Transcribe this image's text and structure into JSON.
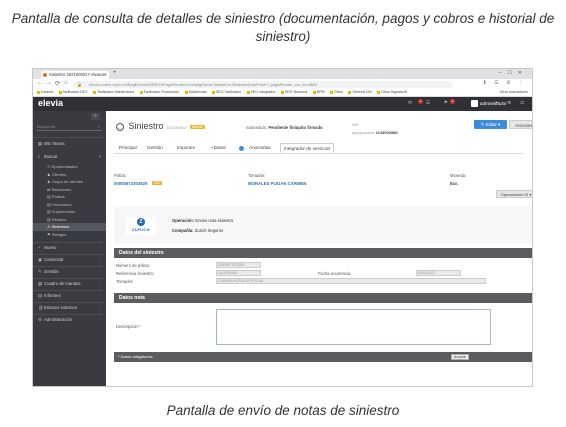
{
  "captions": {
    "top": "Pantalla de consulta de detalles de siniestro (documentación, pagos y cobros e historial de siniestro)",
    "bottom": "Pantalla de envío de notas de siniestro"
  },
  "browser": {
    "tab_title": "Siniestro 2021000017 Alvarez",
    "url": "elevia.zurich.mpm.es/SegElevia/ZURICH/PageRender.mvc/segElevia.Siniestros.SiniestroDataPanel?_pageRender_cnt_id=4884",
    "bookmarks": [
      "Intranet",
      "Tarificador DEV",
      "Tarificador Mantenance",
      "Tarificador Producción",
      "Incidencias",
      "SEG Tarificador",
      "SEG Integrador",
      "SEG Neurona",
      "NPM",
      "Otros",
      "General DM",
      "Otros Signalsoft"
    ],
    "bookmarks_right": "Otros marcadores"
  },
  "app": {
    "logo": "elevia",
    "username": "administrador",
    "badges": [
      "1",
      "2"
    ]
  },
  "sidebar": {
    "search_placeholder": "Búsqueda",
    "items": {
      "mis_tareas": "Mis Tareas",
      "buscar": "Buscar",
      "nuevo": "Nuevo",
      "comercial": "Comercial",
      "gestion": "Gestión",
      "cuadro_mandos": "Cuadro de mandos",
      "informes": "Informes",
      "enlaces_externos": "Enlaces externos",
      "administracion": "Administración"
    },
    "subitems": {
      "oportunidades": "Oportunidades",
      "clientes": "Clientes",
      "grupo_clientes": "Grupo de clientes",
      "relaciones": "Relaciones",
      "polizas": "Pólizas",
      "honorarios": "Honorarios",
      "suplementos": "Suplementos",
      "recibos": "Recibos",
      "siniestros": "Siniestros",
      "riesgos": "Riesgos"
    }
  },
  "header": {
    "title": "Siniestro",
    "claim_number": "2021000017",
    "status_pill": "Abierto",
    "substate_label": "Subestado:",
    "substate_value": "Pendiente finiquito firmado",
    "ref_label": "Ref.",
    "ref_insurer_label": "aseguradora",
    "ref_insurer_value": "1143000585",
    "edit_button": "Editar",
    "actions_button": "Acciones"
  },
  "tabs": [
    "Principal",
    "Gestión",
    "Importes",
    "+Datos",
    "Anomalías",
    "Integrador de servicios"
  ],
  "summary": {
    "poliza_label": "Póliza:",
    "poliza_value": "00005873303529",
    "poliza_pill": "ZFE",
    "tomador_label": "Tomador:",
    "tomador_value": "MORALES PIJUAN CARMEN",
    "moneda_label": "Moneda:",
    "moneda_value": "Eur.",
    "ops_button": "Operaciones IS"
  },
  "operation": {
    "logo_text": "ZURICH",
    "logo_mark": "Z",
    "operacion_label": "Operación:",
    "operacion_value": "Enviar nota siniestro",
    "compania_label": "Compañía:",
    "compania_value": "Zurich Seguros"
  },
  "datos_siniestro": {
    "heading": "Datos del siniestro",
    "numero_poliza_label": "Número de póliza:",
    "numero_poliza_value": "00005873303529",
    "referencia_label": "Referencia siniestro:",
    "referencia_value": "1143000585",
    "fecha_label": "Fecha ocurrencia:",
    "fecha_value": "05/01/2021",
    "tomador_label": "Tomador:",
    "tomador_value": "CARMEN MORALES PIJUAN"
  },
  "datos_nota": {
    "heading": "Datos nota",
    "descripcion_label": "Descripción",
    "required_mark": "*"
  },
  "footer": {
    "required_note": "* Datos obligatorios",
    "accept_button": "Aceptar"
  }
}
